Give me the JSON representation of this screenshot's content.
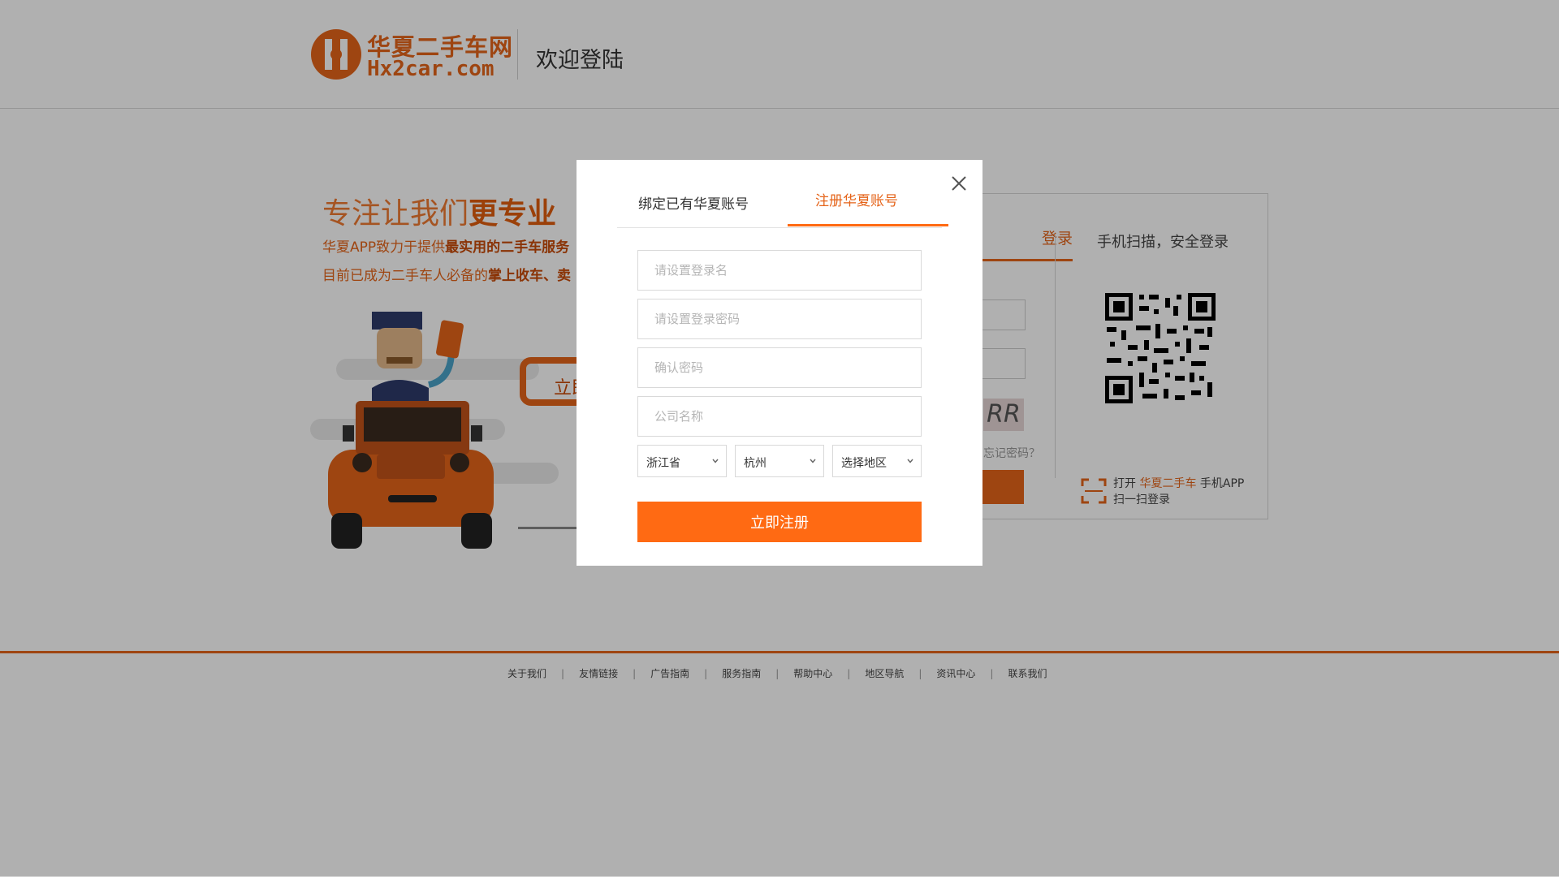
{
  "header": {
    "logo_cn": "华夏二手车网",
    "logo_en": "Hx2car.com",
    "title": "欢迎登陆"
  },
  "hero": {
    "slogan_prefix": "专注让我们",
    "slogan_bold": "更专业",
    "line1_prefix": "华夏APP致力于提供",
    "line1_bold": "最实用的二手车服务",
    "line2_prefix": "目前已成为二手车人必备的",
    "line2_bold": "掌上收车、卖",
    "cta_partial": "立即"
  },
  "login_panel": {
    "tab_account": "登录",
    "tab_scan": "手机扫描，安全登录",
    "captcha_text": "RR",
    "forgot": "忘记密码？",
    "scan_hint_prefix": "打开",
    "scan_hint_brand": "华夏二手车",
    "scan_hint_suffix": "手机APP",
    "scan_hint_line2": "扫一扫登录"
  },
  "footer": {
    "links": [
      "关于我们",
      "友情链接",
      "广告指南",
      "服务指南",
      "帮助中心",
      "地区导航",
      "资讯中心",
      "联系我们"
    ]
  },
  "modal": {
    "tabs": {
      "bind": "绑定已有华夏账号",
      "register": "注册华夏账号",
      "active": "register"
    },
    "fields": {
      "username_placeholder": "请设置登录名",
      "password_placeholder": "请设置登录密码",
      "confirm_placeholder": "确认密码",
      "company_placeholder": "公司名称"
    },
    "selects": {
      "province": "浙江省",
      "city": "杭州",
      "district": "选择地区"
    },
    "submit_label": "立即注册"
  },
  "colors": {
    "brand_orange": "#ff6a13",
    "logo_orange": "#e5641a",
    "overlay": "rgba(0,0,0,0.31)"
  },
  "icons": {
    "close": "close-icon",
    "chevron": "chevron-down-icon",
    "scan": "scan-icon",
    "qr": "qr-code"
  }
}
